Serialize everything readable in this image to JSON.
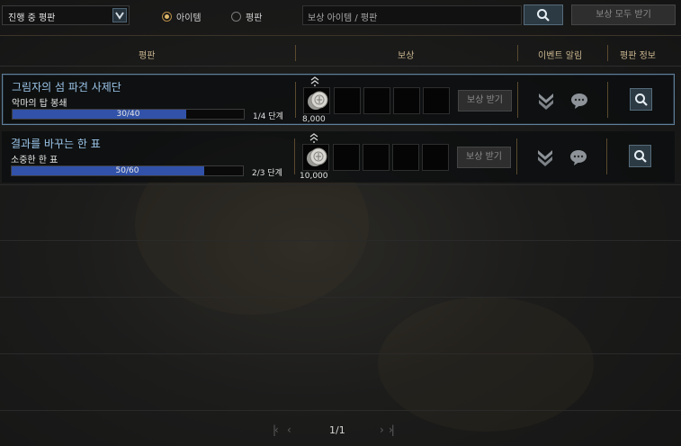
{
  "filter": {
    "dropdown_value": "진행 중 평판"
  },
  "radio": [
    {
      "label": "아이템",
      "selected": true
    },
    {
      "label": "평판",
      "selected": false
    }
  ],
  "search": {
    "placeholder": "보상 아이템 / 평판"
  },
  "claim_all_label": "보상 모두 받기",
  "columns": {
    "reputation": "평판",
    "reward": "보상",
    "event_alert": "이벤트 알림",
    "reputation_info": "평판 정보"
  },
  "rows": [
    {
      "title": "그림자의 섬 파견 사제단",
      "subtitle": "악마의 탑 봉쇄",
      "progress": "30/40",
      "progress_fraction": 0.75,
      "stage": "1/4 단계",
      "reward_amount": "8,000",
      "claim_label": "보상 받기"
    },
    {
      "title": "결과를 바꾸는 한 표",
      "subtitle": "소중한 한 표",
      "progress": "50/60",
      "progress_fraction": 0.8333,
      "stage": "2/3 단계",
      "reward_amount": "10,000",
      "claim_label": "보상 받기"
    }
  ],
  "pagination": {
    "page": "1/1"
  },
  "colors": {
    "accent_blue": "#3152a8",
    "title_blue": "#9cc6ea",
    "header_gold": "#c8b48e"
  },
  "icons": [
    "chevron-down-icon",
    "search-icon",
    "coin-icon",
    "pin-icon",
    "double-chevron-down-icon",
    "chat-bubble-icon",
    "first-page-icon",
    "prev-page-icon",
    "next-page-icon",
    "last-page-icon"
  ]
}
